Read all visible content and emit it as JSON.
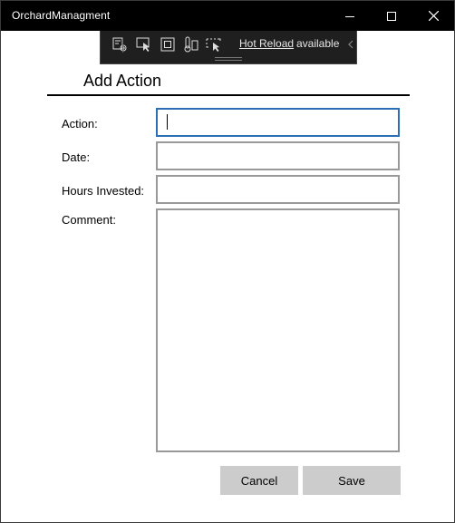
{
  "window": {
    "title": "OrchardManagment"
  },
  "devtools": {
    "hot_reload_link": "Hot Reload",
    "status": "available",
    "tools": [
      "live-visual-tree-icon",
      "select-element-icon",
      "display-layout-adorners-icon",
      "track-focus-icon",
      "preview-selection-icon"
    ]
  },
  "page": {
    "title": "Add Action"
  },
  "form": {
    "action_label": "Action:",
    "action_value": "",
    "date_label": "Date:",
    "date_value": "",
    "hours_label": "Hours Invested:",
    "hours_value": "",
    "comment_label": "Comment:",
    "comment_value": ""
  },
  "buttons": {
    "cancel_label": "Cancel",
    "save_label": "Save"
  },
  "colors": {
    "titlebar_bg": "#000000",
    "devbar_bg": "#1f1f1f",
    "focus_border": "#2c6fb4",
    "field_border": "#999999",
    "button_bg": "#cccccc"
  }
}
